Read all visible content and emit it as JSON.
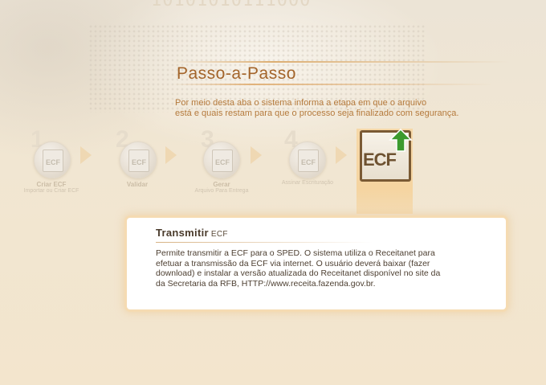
{
  "background": {
    "binary_text": "10101010111000"
  },
  "header": {
    "title": "Passo-a-Passo",
    "intro_lines": [
      "Por meio desta aba o sistema informa a etapa em que o arquivo",
      "está e quais restam para que o processo seja finalizado com segurança."
    ]
  },
  "steps": [
    {
      "number": "1",
      "icon": "ecf-document-icon",
      "icon_text": "ECF",
      "label": "Criar ECF",
      "sublabel": "Importar ou Criar ECF",
      "state": "inactive"
    },
    {
      "number": "2",
      "icon": "ecf-validate-icon",
      "icon_text": "ECF",
      "label": "Validar",
      "sublabel": "",
      "state": "inactive"
    },
    {
      "number": "3",
      "icon": "ecf-generate-icon",
      "icon_text": "ECF",
      "label": "Gerar",
      "sublabel": "Arquivo Para Entrega",
      "state": "inactive"
    },
    {
      "number": "4",
      "icon": "ecf-sign-icon",
      "icon_text": "",
      "label": "",
      "sublabel": "Assinar Escrituração",
      "state": "inactive"
    },
    {
      "number": "",
      "icon": "ecf-transmit-icon",
      "icon_text": "ECF",
      "label": "",
      "sublabel": "",
      "state": "active"
    }
  ],
  "detail": {
    "title": "Transmitir",
    "title_suffix": "ECF",
    "body_lines": [
      "Permite transmitir a ECF para o SPED. O sistema utiliza o Receitanet para",
      "efetuar a transmissão da ECF via internet.  O usuário deverá baixar (fazer",
      "download) e instalar a versão atualizada do Receitanet disponível no site da",
      "da Secretaria da RFB, HTTP://www.receita.fazenda.gov.br."
    ]
  },
  "colors": {
    "title": "#a3642a",
    "intro": "#b57a3c",
    "active_highlight": "#f5d4a0",
    "arrow_green": "#3c9a2e",
    "ecf_border": "#7a5a34"
  }
}
